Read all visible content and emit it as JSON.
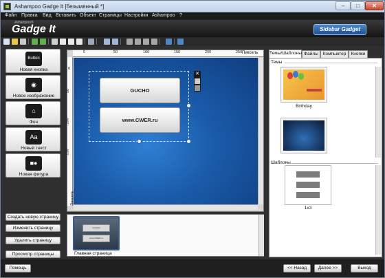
{
  "window": {
    "title": "Ashampoo Gadge It [безымянный *]",
    "controls": {
      "minimize": "–",
      "maximize": "□",
      "close": "✕"
    }
  },
  "menu": [
    "Файл",
    "Правка",
    "Вид",
    "Вставить",
    "Объект",
    "Страницы",
    "Настройки",
    "Ashampoo",
    "?"
  ],
  "banner": {
    "brand_small": "Ashampoo®",
    "brand": "Gadge It",
    "sidebar_gadget": "Sidebar Gadget"
  },
  "tools": [
    {
      "label": "Новая кнопка",
      "icon": "button-icon",
      "glyph": "Button"
    },
    {
      "label": "Новое изображение",
      "icon": "camera-icon",
      "glyph": "◉"
    },
    {
      "label": "Фон",
      "icon": "background-icon",
      "glyph": "⌂"
    },
    {
      "label": "Новый текст",
      "icon": "text-icon",
      "glyph": "Aa"
    },
    {
      "label": "Новая фигура",
      "icon": "shape-icon",
      "glyph": "■●"
    }
  ],
  "page_buttons": [
    "Создать новую страницу",
    "Изменить страницу",
    "Удалить страницу",
    "Просмотр страницы"
  ],
  "ruler": {
    "units": "Пиксель",
    "top_ticks": [
      "0",
      "50",
      "100",
      "150",
      "200",
      "250"
    ],
    "left_ticks": [
      "0",
      "50",
      "100",
      "150"
    ]
  },
  "canvas": {
    "buttons": [
      "GUCHO",
      "www.CWER.ru"
    ]
  },
  "pages": {
    "thumbnail_label": "Главная страница",
    "thumb_texts": [
      "GUCHO",
      "www.CWER.ru"
    ]
  },
  "right_tabs": [
    "Темы/Шаблоны",
    "Файлы",
    "Компьютер",
    "Кнопки"
  ],
  "themes": {
    "section": "Темы",
    "items": [
      "Birthday"
    ]
  },
  "templates": {
    "section": "Шаблоны",
    "items": [
      "1x3"
    ]
  },
  "bottom": {
    "help": "Помощь",
    "back": "<< Назад",
    "next": "Далее >>",
    "exit": "Выход"
  },
  "colors": {
    "canvas_blue": "#1a5aa8",
    "accent": "#2a6bb8",
    "dark_chrome": "#2f2f2f"
  }
}
